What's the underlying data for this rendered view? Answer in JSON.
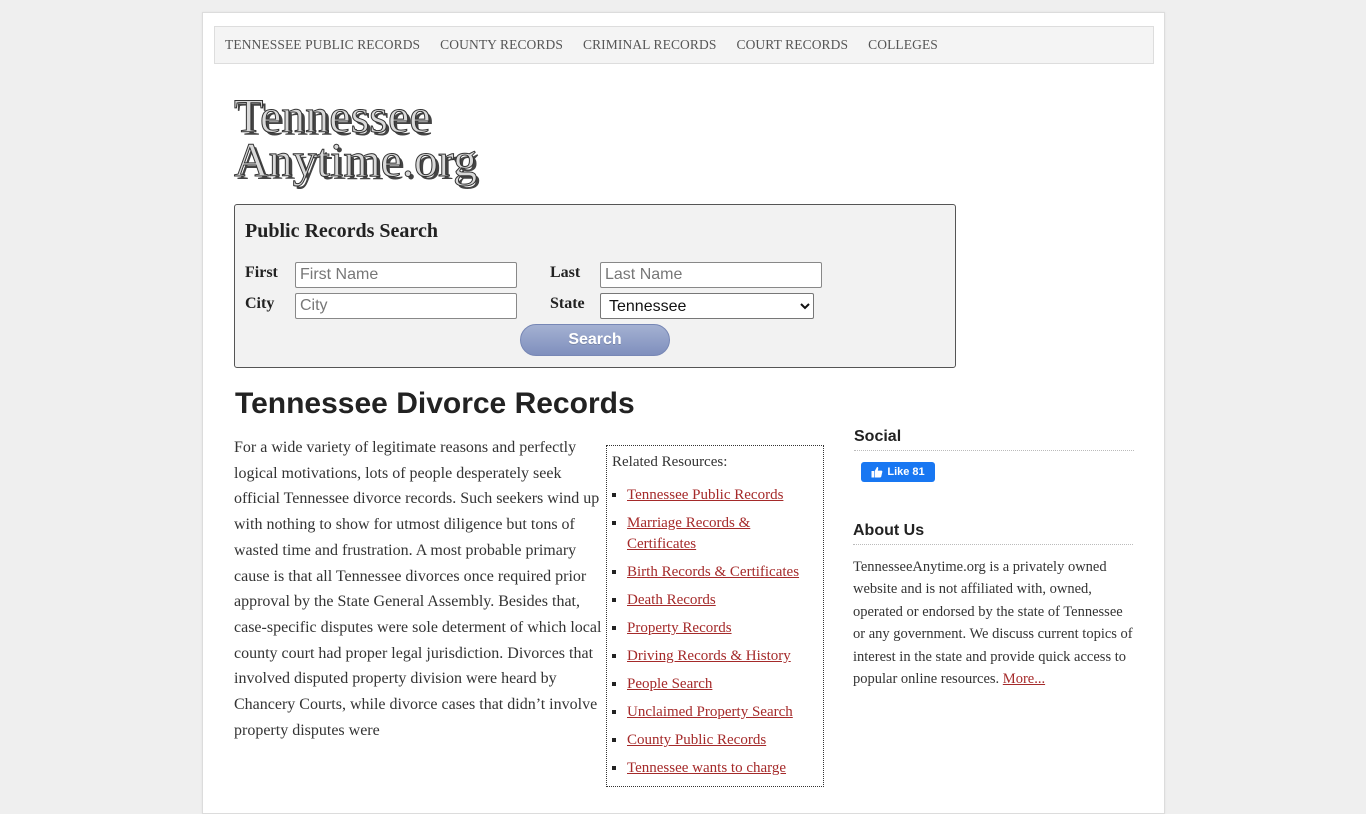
{
  "nav": {
    "items": [
      {
        "label": "TENNESSEE PUBLIC RECORDS"
      },
      {
        "label": "COUNTY RECORDS"
      },
      {
        "label": "CRIMINAL RECORDS"
      },
      {
        "label": "COURT RECORDS"
      },
      {
        "label": "COLLEGES"
      }
    ]
  },
  "logo": {
    "line1": "Tennessee",
    "line2": "Anytime.org"
  },
  "search": {
    "title": "Public Records Search",
    "first_label": "First",
    "first_placeholder": "First Name",
    "last_label": "Last",
    "last_placeholder": "Last Name",
    "city_label": "City",
    "city_placeholder": "City",
    "state_label": "State",
    "state_value": "Tennessee",
    "button_label": "Search"
  },
  "main": {
    "title": "Tennessee Divorce Records",
    "body": "For a wide variety of legitimate reasons and perfectly logical motivations, lots of people desperately seek official Tennessee divorce records. Such seekers wind up with nothing to show for utmost diligence but tons of wasted time and frustration. A most probable primary cause is that all Tennessee divorces once required prior approval by the State General Assembly. Besides that, case-specific disputes were sole determent of which local county court had proper legal jurisdiction. Divorces that involved disputed property division were heard by Chancery Courts, while divorce cases that didn’t involve property disputes were"
  },
  "related": {
    "title": "Related Resources:",
    "links": [
      {
        "label": "Tennessee Public Records"
      },
      {
        "label": "Marriage Records & Certificates"
      },
      {
        "label": "Birth Records & Certificates"
      },
      {
        "label": "Death Records"
      },
      {
        "label": "Property Records"
      },
      {
        "label": "Driving Records & History"
      },
      {
        "label": "People Search"
      },
      {
        "label": "Unclaimed Property Search"
      },
      {
        "label": "County Public Records"
      },
      {
        "label": "Tennessee wants to charge"
      }
    ]
  },
  "sidebar": {
    "social_heading": "Social",
    "like_label": "Like 81",
    "about_heading": "About Us",
    "about_text": "TennesseeAnytime.org is a privately owned website and is not affiliated with, owned, operated or endorsed by the state of Tennessee or any government. We discuss current topics of interest in the state and provide quick access to popular online resources.",
    "more_label": "More..."
  },
  "colors": {
    "link": "#a52a2a",
    "button": "#8696c3",
    "facebook": "#1877f2"
  }
}
